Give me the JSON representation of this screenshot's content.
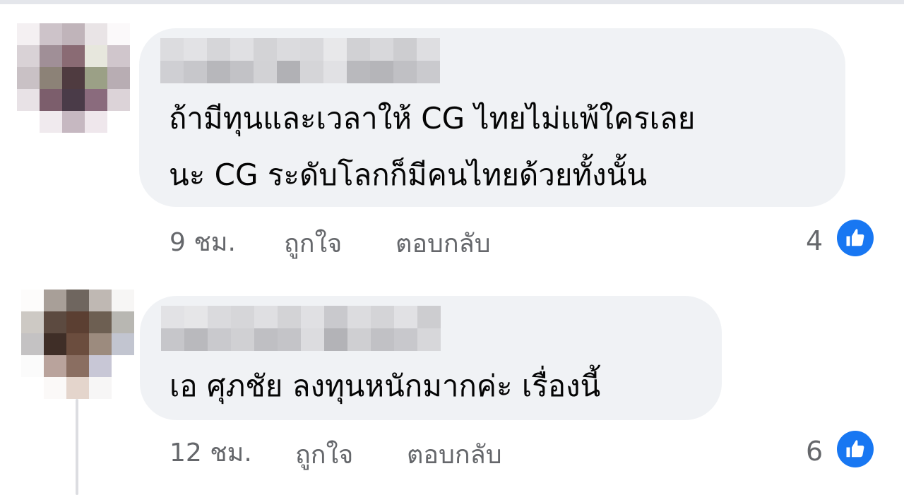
{
  "comments": [
    {
      "text_lines": [
        "ถ้ามีทุนและเวลาให้ CG ไทยไม่แพ้ใครเลย",
        "นะ CG ระดับโลกก็มีคนไทยด้วยทั้งนั้น"
      ],
      "time": "9 ชม.",
      "like_label": "ถูกใจ",
      "reply_label": "ตอบกลับ",
      "reaction_count": "4",
      "reaction_icon": "thumbs-up-icon"
    },
    {
      "text_lines": [
        "เอ ศุภชัย ลงทุนหนักมากค่ะ เรื่องนี้"
      ],
      "time": "12 ชม.",
      "like_label": "ถูกใจ",
      "reply_label": "ตอบกลับ",
      "reaction_count": "6",
      "reaction_icon": "thumbs-up-icon"
    }
  ],
  "colors": {
    "bubble": "#f0f2f5",
    "meta_text": "#65676b",
    "like_blue": "#1877f2"
  }
}
